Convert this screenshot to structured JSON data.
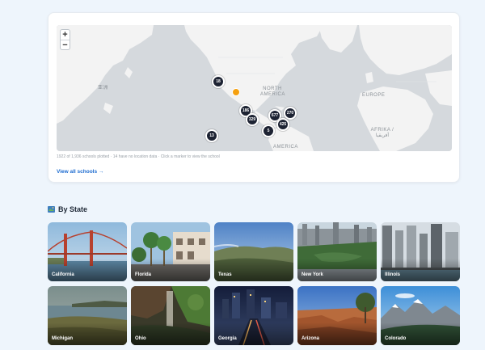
{
  "map": {
    "zoom_in": "+",
    "zoom_out": "−",
    "labels": {
      "asia": "亚洲",
      "north_america": "NORTH AMERICA",
      "europe": "EUROPE",
      "africa": "AFRIKA / أفريقيا",
      "america": "AMERICA"
    },
    "clusters": [
      {
        "count": "18"
      },
      {
        "count": "186"
      },
      {
        "count": "677"
      },
      {
        "count": "270"
      },
      {
        "count": "329"
      },
      {
        "count": "425"
      },
      {
        "count": "5"
      },
      {
        "count": "13"
      }
    ],
    "pin_color": "#f5a00f",
    "note": "1922 of 1,936 schools plotted · 14 have no location data · Click a marker to view the school",
    "view_all": "View all schools →"
  },
  "states_section": {
    "title": "By State",
    "icon": "map-icon",
    "states": [
      {
        "name": "California"
      },
      {
        "name": "Florida"
      },
      {
        "name": "Texas"
      },
      {
        "name": "New York"
      },
      {
        "name": "Illinois"
      },
      {
        "name": "Michigan"
      },
      {
        "name": "Ohio"
      },
      {
        "name": "Georgia"
      },
      {
        "name": "Arizona"
      },
      {
        "name": "Colorado"
      }
    ]
  },
  "colors": {
    "page_bg": "#eef5fc",
    "link": "#1c6bd0",
    "cluster": "#1d2333"
  }
}
